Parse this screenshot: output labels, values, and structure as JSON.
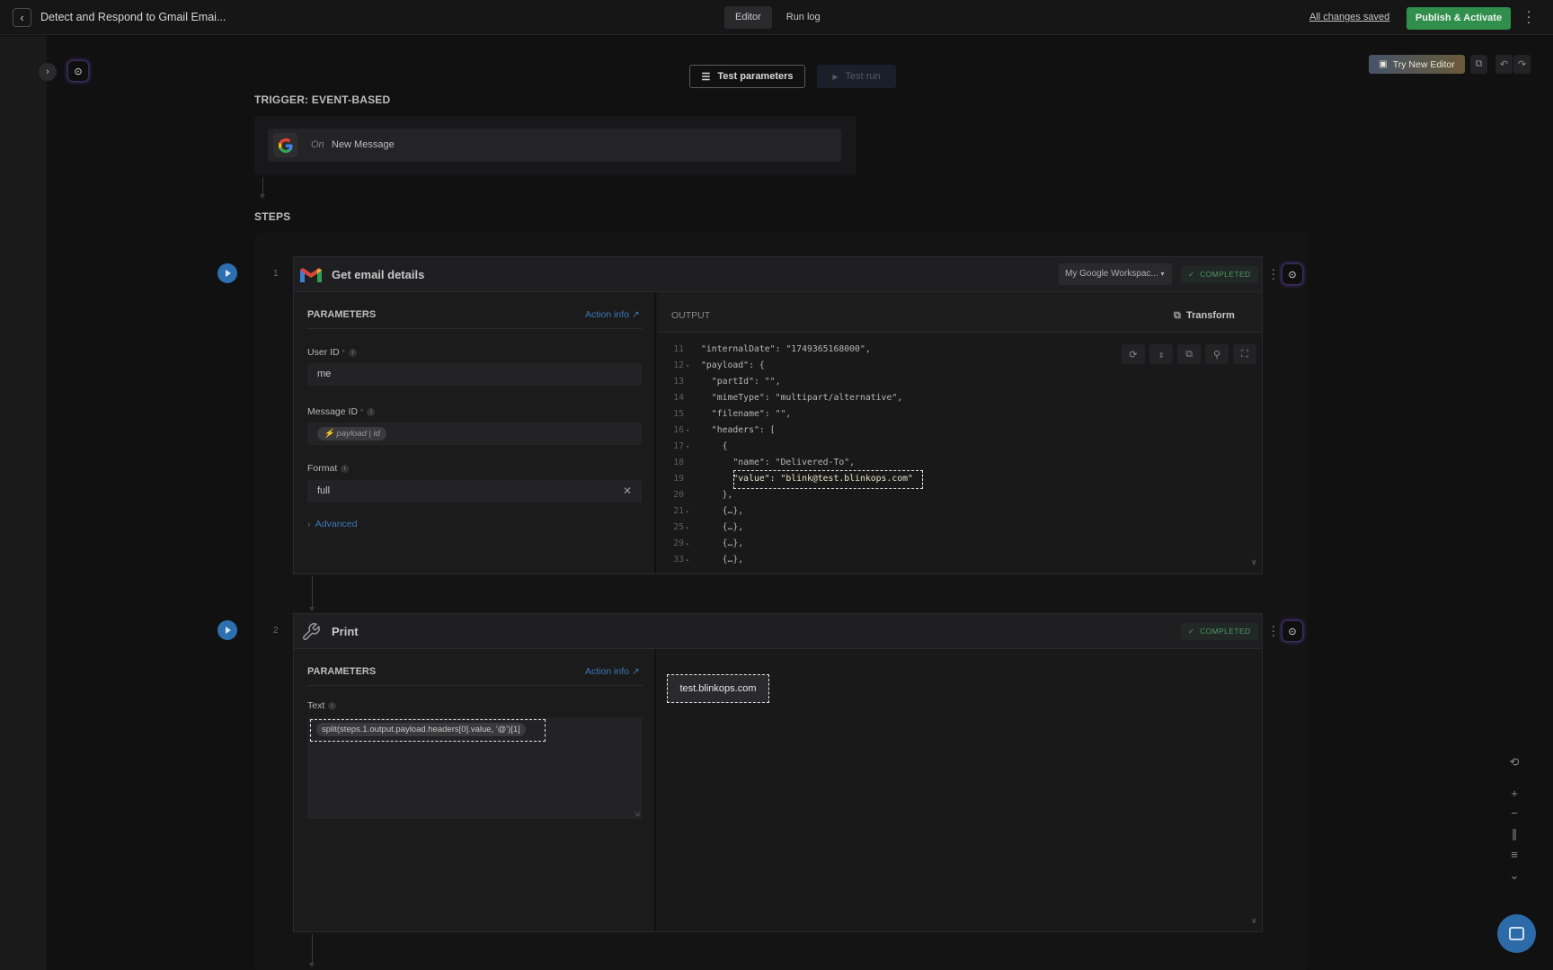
{
  "topbar": {
    "back_icon": "chevron-left-icon",
    "title": "Detect and Respond to Gmail Emai...",
    "tabs": [
      {
        "label": "Editor",
        "active": true
      },
      {
        "label": "Run log",
        "active": false
      }
    ],
    "saved_status": "All changes saved",
    "publish_label": "Publish & Activate",
    "publish_color": "#2f8f4b"
  },
  "canvas_toolbar": {
    "test_parameters_label": "Test parameters",
    "test_run_label": "Test run",
    "try_new_editor_label": "Try New Editor"
  },
  "trigger": {
    "section_label": "TRIGGER: EVENT-BASED",
    "on_label": "On",
    "event_name": "New Message",
    "icon": "google-icon"
  },
  "steps_label": "STEPS",
  "steps": [
    {
      "number": "1",
      "title": "Get email details",
      "icon": "gmail-icon",
      "connection": "My Google Workspac...",
      "status": "COMPLETED",
      "params": {
        "header": "PARAMETERS",
        "action_info": "Action info",
        "fields": [
          {
            "label": "User ID",
            "required": true,
            "value": "me"
          },
          {
            "label": "Message ID",
            "required": true,
            "chip": "payload | id"
          },
          {
            "label": "Format",
            "required": false,
            "value": "full"
          }
        ],
        "advanced_label": "Advanced"
      },
      "output": {
        "header": "OUTPUT",
        "transform_label": "Transform",
        "lines": [
          {
            "n": "11",
            "fold": "",
            "text": "\"internalDate\": \"1749365168000\","
          },
          {
            "n": "12",
            "fold": "▾",
            "text": "\"payload\": {"
          },
          {
            "n": "13",
            "fold": "",
            "text": "  \"partId\": \"\","
          },
          {
            "n": "14",
            "fold": "",
            "text": "  \"mimeType\": \"multipart/alternative\","
          },
          {
            "n": "15",
            "fold": "",
            "text": "  \"filename\": \"\","
          },
          {
            "n": "16",
            "fold": "▾",
            "text": "  \"headers\": ["
          },
          {
            "n": "17",
            "fold": "▾",
            "text": "    {"
          },
          {
            "n": "18",
            "fold": "",
            "text": "      \"name\": \"Delivered-To\","
          },
          {
            "n": "19",
            "fold": "",
            "text": "      \"value\": \"blink@test.blinkops.com\""
          },
          {
            "n": "20",
            "fold": "",
            "text": "    },"
          },
          {
            "n": "21",
            "fold": "▸",
            "text": "    {…},"
          },
          {
            "n": "25",
            "fold": "▸",
            "text": "    {…},"
          },
          {
            "n": "29",
            "fold": "▸",
            "text": "    {…},"
          },
          {
            "n": "33",
            "fold": "▸",
            "text": "    {…},"
          }
        ]
      }
    },
    {
      "number": "2",
      "title": "Print",
      "icon": "wrench-icon",
      "status": "COMPLETED",
      "params": {
        "header": "PARAMETERS",
        "action_info": "Action info",
        "text_label": "Text",
        "text_expression": "split(steps.1.output.payload.headers[0].value, '@')[1]"
      },
      "output": {
        "result": "test.blinkops.com"
      }
    }
  ]
}
